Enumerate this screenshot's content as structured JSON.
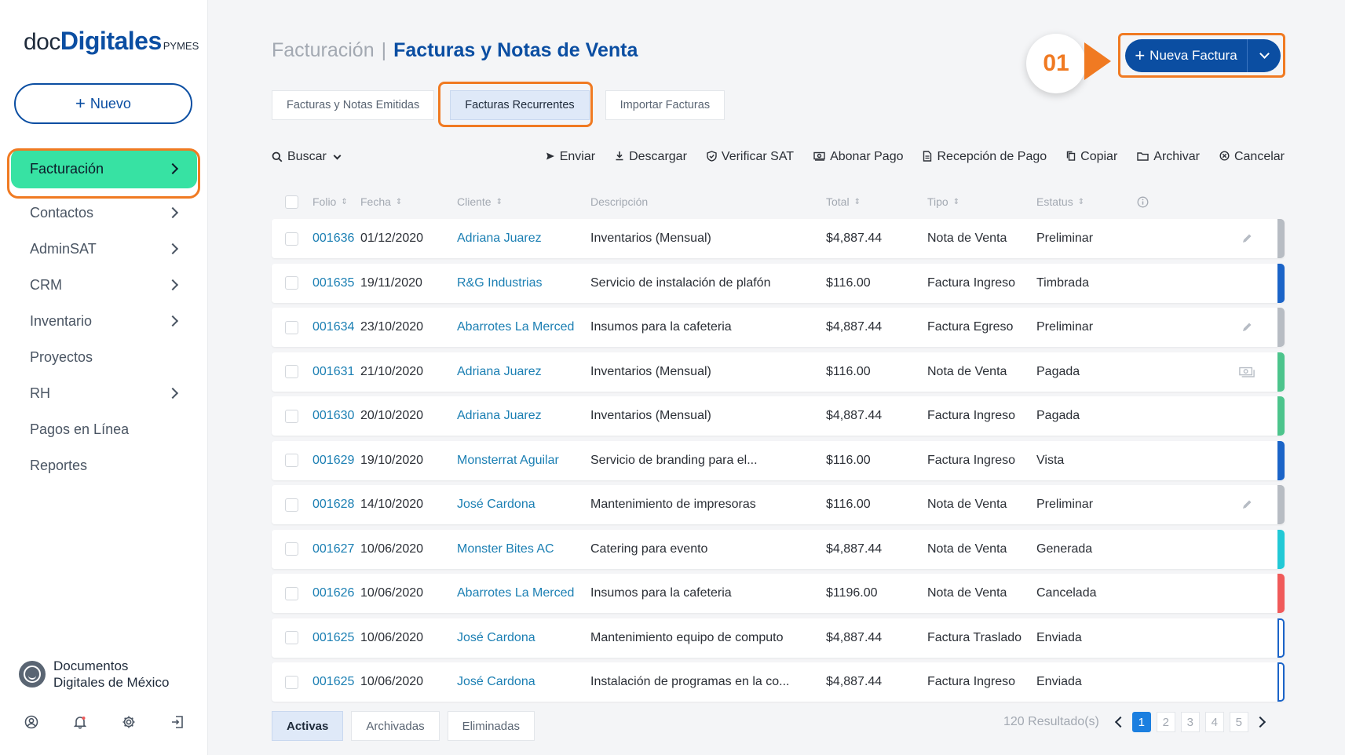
{
  "app": {
    "logo": {
      "part1": "doc",
      "part2": "Digitales",
      "part3": "PYMES"
    },
    "new_button": "Nuevo"
  },
  "sidebar": {
    "items": [
      {
        "label": "Facturación",
        "has_chevron": true,
        "active": true
      },
      {
        "label": "Contactos",
        "has_chevron": true
      },
      {
        "label": "AdminSAT",
        "has_chevron": true
      },
      {
        "label": "CRM",
        "has_chevron": true
      },
      {
        "label": "Inventario",
        "has_chevron": true
      },
      {
        "label": "Proyectos",
        "has_chevron": false
      },
      {
        "label": "RH",
        "has_chevron": true
      },
      {
        "label": "Pagos en Línea",
        "has_chevron": false
      },
      {
        "label": "Reportes",
        "has_chevron": false
      }
    ],
    "org": {
      "line1": "Documentos",
      "line2": "Digitales de México"
    },
    "bottom_icons": [
      "user-icon",
      "bell-icon",
      "gear-icon",
      "logout-icon"
    ]
  },
  "header": {
    "breadcrumb": "Facturación",
    "separator": "|",
    "title": "Facturas y Notas de Venta",
    "step": "01",
    "new_invoice": "Nueva Factura"
  },
  "tabs": [
    {
      "label": "Facturas y Notas Emitidas",
      "active": false
    },
    {
      "label": "Facturas Recurrentes",
      "active": true
    },
    {
      "label": "Importar Facturas",
      "active": false
    }
  ],
  "toolbar": {
    "search": "Buscar",
    "actions": [
      {
        "label": "Enviar",
        "icon": "send-icon"
      },
      {
        "label": "Descargar",
        "icon": "download-icon"
      },
      {
        "label": "Verificar SAT",
        "icon": "shield-check-icon"
      },
      {
        "label": "Abonar Pago",
        "icon": "money-icon"
      },
      {
        "label": "Recepción de Pago",
        "icon": "document-icon"
      },
      {
        "label": "Copiar",
        "icon": "copy-icon"
      },
      {
        "label": "Archivar",
        "icon": "folder-icon"
      },
      {
        "label": "Cancelar",
        "icon": "cancel-icon"
      }
    ]
  },
  "table": {
    "columns": [
      "Folio",
      "Fecha",
      "Cliente",
      "Descripción",
      "Total",
      "Tipo",
      "Estatus"
    ],
    "rows": [
      {
        "folio": "001636",
        "fecha": "01/12/2020",
        "cliente": "Adriana Juarez",
        "descripcion": "Inventarios (Mensual)",
        "total": "$4,887.44",
        "tipo": "Nota de Venta",
        "estatus": "Preliminar",
        "row_icon": "pencil-icon",
        "status_color": "#b7bcc3",
        "outline": false
      },
      {
        "folio": "001635",
        "fecha": "19/11/2020",
        "cliente": "R&G Industrias",
        "descripcion": "Servicio de instalación de plafón",
        "total": "$116.00",
        "tipo": "Factura Ingreso",
        "estatus": "Timbrada",
        "row_icon": "",
        "status_color": "#1b64c8",
        "outline": false
      },
      {
        "folio": "001634",
        "fecha": "23/10/2020",
        "cliente": "Abarrotes La Merced",
        "descripcion": "Insumos para la cafeteria",
        "total": "$4,887.44",
        "tipo": "Factura Egreso",
        "estatus": "Preliminar",
        "row_icon": "pencil-icon",
        "status_color": "#b7bcc3",
        "outline": false
      },
      {
        "folio": "001631",
        "fecha": "21/10/2020",
        "cliente": "Adriana Juarez",
        "descripcion": "Inventarios (Mensual)",
        "total": "$116.00",
        "tipo": "Nota de Venta",
        "estatus": "Pagada",
        "row_icon": "money-icon",
        "status_color": "#4cc48c",
        "outline": false
      },
      {
        "folio": "001630",
        "fecha": "20/10/2020",
        "cliente": "Adriana Juarez",
        "descripcion": "Inventarios (Mensual)",
        "total": "$4,887.44",
        "tipo": "Factura Ingreso",
        "estatus": "Pagada",
        "row_icon": "",
        "status_color": "#4cc48c",
        "outline": false
      },
      {
        "folio": "001629",
        "fecha": "19/10/2020",
        "cliente": "Monsterrat Aguilar",
        "descripcion": "Servicio de branding para el...",
        "total": "$116.00",
        "tipo": "Factura Ingreso",
        "estatus": "Vista",
        "row_icon": "",
        "status_color": "#1b64c8",
        "outline": false
      },
      {
        "folio": "001628",
        "fecha": "14/10/2020",
        "cliente": "José Cardona",
        "descripcion": "Mantenimiento de impresoras",
        "total": "$116.00",
        "tipo": "Nota de Venta",
        "estatus": "Preliminar",
        "row_icon": "pencil-icon",
        "status_color": "#b7bcc3",
        "outline": false
      },
      {
        "folio": "001627",
        "fecha": "10/06/2020",
        "cliente": "Monster Bites AC",
        "descripcion": "Catering para evento",
        "total": "$4,887.44",
        "tipo": "Nota de Venta",
        "estatus": "Generada",
        "row_icon": "",
        "status_color": "#22c9d6",
        "outline": false
      },
      {
        "folio": "001626",
        "fecha": "10/06/2020",
        "cliente": "Abarrotes La Merced",
        "descripcion": "Insumos para la cafeteria",
        "total": "$1196.00",
        "tipo": "Nota de Venta",
        "estatus": "Cancelada",
        "row_icon": "",
        "status_color": "#f05a5a",
        "outline": false
      },
      {
        "folio": "001625",
        "fecha": "10/06/2020",
        "cliente": "José Cardona",
        "descripcion": "Mantenimiento equipo de computo",
        "total": "$4,887.44",
        "tipo": "Factura Traslado",
        "estatus": "Enviada",
        "row_icon": "",
        "status_color": "#1b64c8",
        "outline": true
      },
      {
        "folio": "001625",
        "fecha": "10/06/2020",
        "cliente": "José Cardona",
        "descripcion": "Instalación de programas en la co...",
        "total": "$4,887.44",
        "tipo": "Factura Ingreso",
        "estatus": "Enviada",
        "row_icon": "",
        "status_color": "#1b64c8",
        "outline": true
      }
    ]
  },
  "bottom_tabs": [
    {
      "label": "Activas",
      "active": true
    },
    {
      "label": "Archivadas",
      "active": false
    },
    {
      "label": "Eliminadas",
      "active": false
    }
  ],
  "pagination": {
    "results": "120 Resultado(s)",
    "pages": [
      "1",
      "2",
      "3",
      "4",
      "5"
    ],
    "current": "1"
  },
  "colors": {
    "brand": "#0b4ea2",
    "active_nav": "#37e2a3",
    "highlight": "#f07a22",
    "link": "#1b7fb3"
  }
}
